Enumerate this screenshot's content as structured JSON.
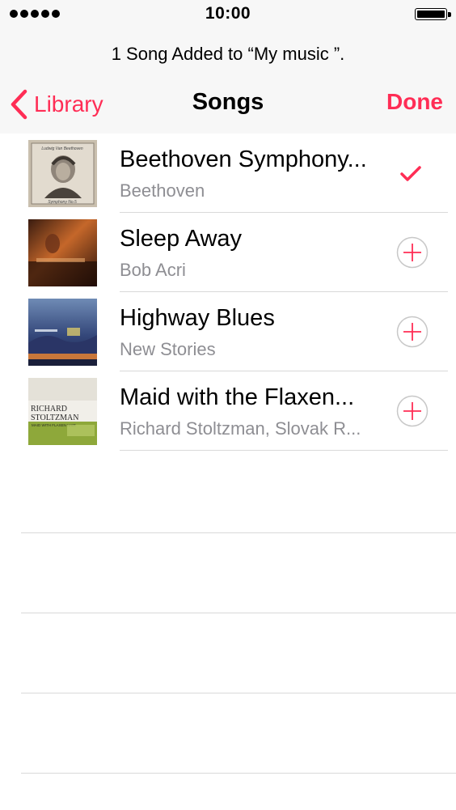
{
  "status_bar": {
    "time": "10:00",
    "signal_icon": "signal-dots-icon",
    "battery_icon": "battery-icon"
  },
  "prompt": "1 Song Added to “My music ”.",
  "nav": {
    "back_label": "Library",
    "title": "Songs",
    "done_label": "Done"
  },
  "accent_color": "#ff2d55",
  "songs": [
    {
      "title": "Beethoven Symphony...",
      "artist": "Beethoven",
      "added": true,
      "action_icon": "checkmark-icon"
    },
    {
      "title": "Sleep Away",
      "artist": "Bob Acri",
      "added": false,
      "action_icon": "add-circle-icon"
    },
    {
      "title": "Highway Blues",
      "artist": "New Stories",
      "added": false,
      "action_icon": "add-circle-icon"
    },
    {
      "title": "Maid with the Flaxen...",
      "artist": "Richard Stoltzman, Slovak R...",
      "added": false,
      "action_icon": "add-circle-icon"
    }
  ],
  "album_art_text": {
    "beethoven_script": "Ludwig Van Beethoven",
    "beethoven_bottom": "Symphony No.5",
    "stoltzman_name_1": "RICHARD",
    "stoltzman_name_2": "STOLTZMAN",
    "stoltzman_sub": "MAID WITH FLAXEN HAIR"
  }
}
